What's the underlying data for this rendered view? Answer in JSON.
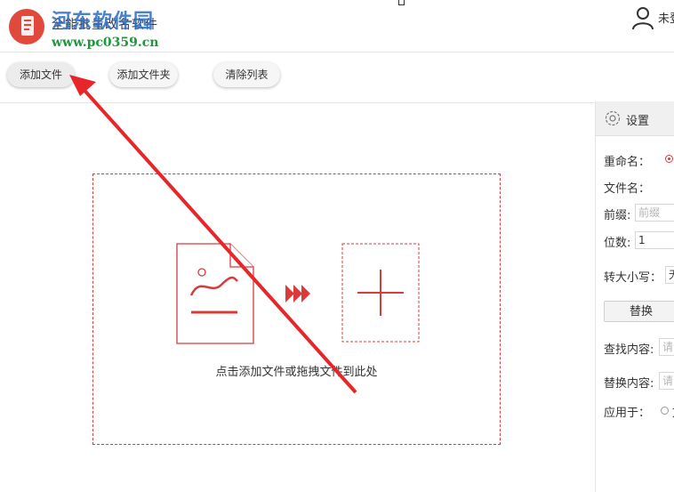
{
  "header": {
    "app_title": "全能批量改名软件",
    "watermark_name": "河东软件园",
    "watermark_url": "www.pc0359.cn",
    "user_label": "未登"
  },
  "toolbar": {
    "add_file": "添加文件",
    "add_folder": "添加文件夹",
    "clear_list": "清除列表"
  },
  "dropzone": {
    "hint": "点击添加文件或拖拽文件到此处"
  },
  "settings": {
    "title": "设置",
    "rename_label": "重命名：",
    "filename_label": "文件名：",
    "prefix_label": "前缀:",
    "prefix_placeholder": "前缀",
    "digits_label": "位数:",
    "digits_value": "1",
    "case_label": "转大小写：",
    "case_value": "无",
    "replace_button": "替换",
    "find_label": "查找内容:",
    "find_placeholder": "请",
    "replace_label": "替换内容:",
    "replace_placeholder": "请",
    "apply_label": "应用于：",
    "apply_option": "文"
  },
  "icons": {
    "settings": "gear-icon",
    "user": "user-icon",
    "document": "document-image-icon",
    "forward": "triple-chevron-icon",
    "add": "plus-icon"
  },
  "colors": {
    "accent": "#d93b3b",
    "annotation_arrow": "#e8262a"
  }
}
